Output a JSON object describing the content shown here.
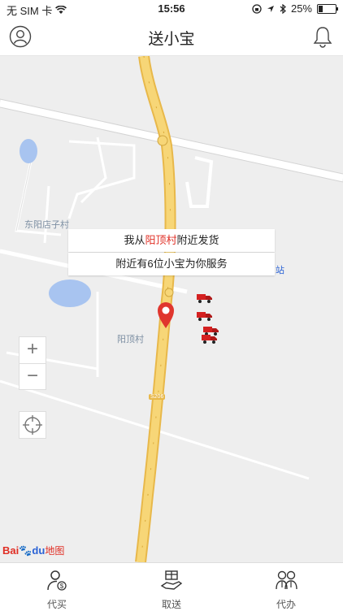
{
  "status_bar": {
    "carrier": "无 SIM 卡",
    "time": "15:56",
    "battery": "25%",
    "battery_level": 0.25
  },
  "nav": {
    "title": "送小宝",
    "left_icon": "user-icon",
    "right_icon": "bell-icon"
  },
  "map": {
    "labels": {
      "village_1": "东阳店子村",
      "village_2": "阳顶村",
      "station": "站",
      "road_badge": "S206"
    },
    "popup": {
      "line1_prefix": "我从",
      "line1_highlight": "阳顶村",
      "line1_suffix": "附近发货",
      "line2": "附近有6位小宝为你服务"
    },
    "highlight_color": "#e02e24",
    "controls": {
      "zoom_in": "+",
      "zoom_out": "−"
    },
    "logo": {
      "bai": "Bai",
      "du": "du",
      "map": "地图"
    }
  },
  "tabs": [
    {
      "label": "代买",
      "icon": "person-dollar-icon"
    },
    {
      "label": "取送",
      "icon": "gift-hand-icon"
    },
    {
      "label": "代办",
      "icon": "two-persons-icon"
    }
  ]
}
